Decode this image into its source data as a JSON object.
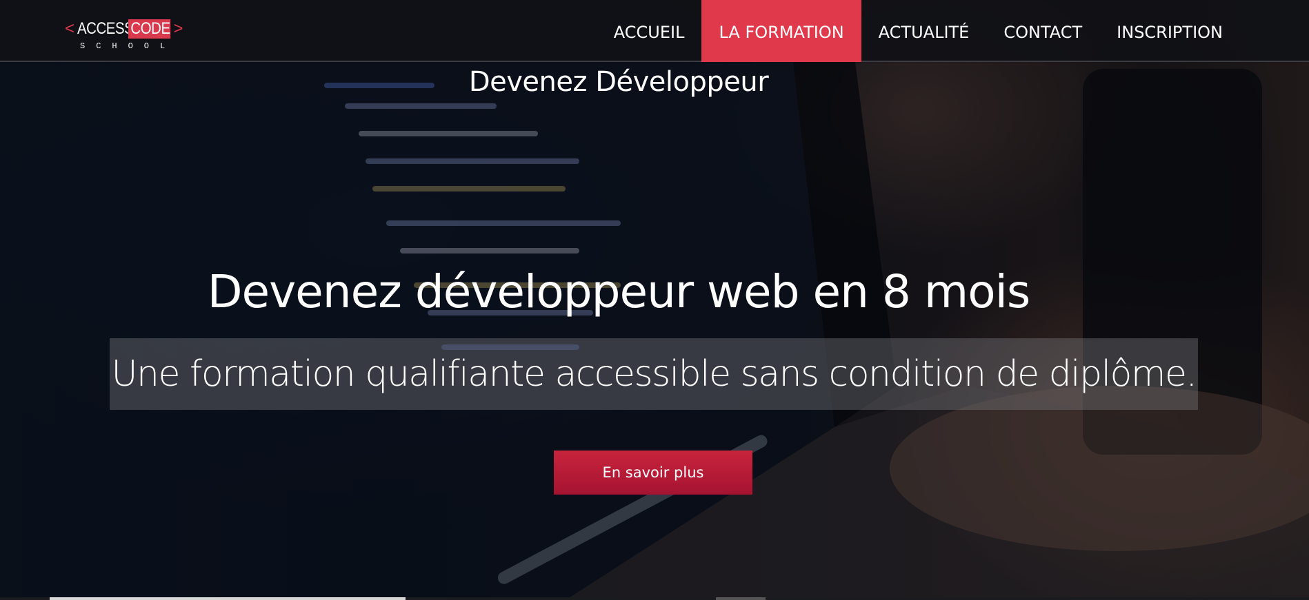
{
  "brand": {
    "logo_left_bracket": "<",
    "logo_access": "ACCESS",
    "logo_code": "CODE",
    "logo_right_bracket": ">",
    "logo_school": "SCHOOL",
    "accent_color": "#e0394c"
  },
  "nav": {
    "items": [
      {
        "label": "ACCUEIL",
        "active": false
      },
      {
        "label": "LA FORMATION",
        "active": true
      },
      {
        "label": "ACTUALITÉ",
        "active": false
      },
      {
        "label": "CONTACT",
        "active": false
      },
      {
        "label": "INSCRIPTION",
        "active": false
      }
    ]
  },
  "hero": {
    "top_heading": "Devenez Développeur",
    "title": "Devenez développeur web en 8 mois",
    "subtitle": "Une formation qualifiante accessible sans condition de diplôme.",
    "cta_label": "En savoir plus"
  }
}
